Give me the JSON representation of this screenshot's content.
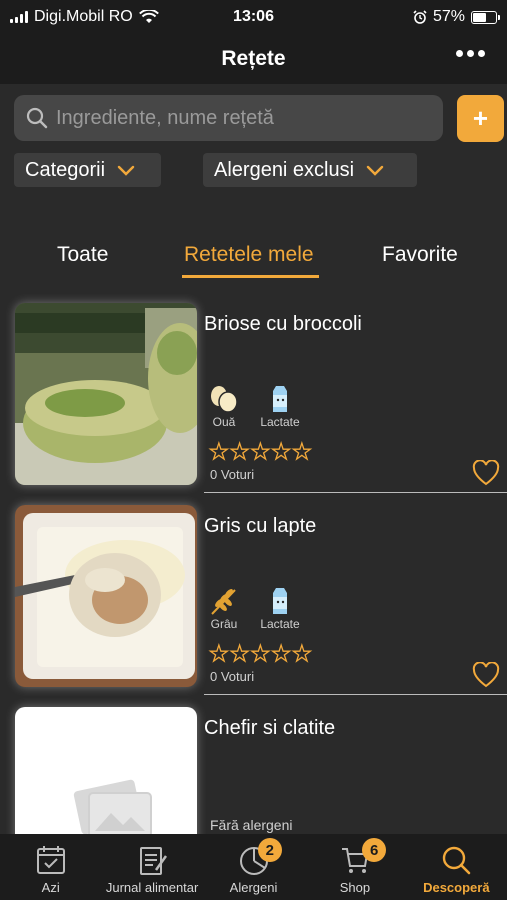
{
  "status_bar": {
    "carrier": "Digi.Mobil RO",
    "time": "13:06",
    "battery": "57%",
    "battery_level": 0.57
  },
  "header": {
    "title": "Rețete"
  },
  "search": {
    "placeholder": "Ingrediente, nume rețetă",
    "add_label": "+"
  },
  "filters": {
    "categories": "Categorii",
    "allergens": "Alergeni exclusi"
  },
  "tabs": [
    {
      "label": "Toate",
      "active": false
    },
    {
      "label": "Retetele mele",
      "active": true
    },
    {
      "label": "Favorite",
      "active": false
    }
  ],
  "recipes": [
    {
      "title": "Briose cu broccoli",
      "allergens": [
        {
          "label": "Ouă",
          "icon": "eggs-icon"
        },
        {
          "label": "Lactate",
          "icon": "milk-icon"
        }
      ],
      "rating": 0,
      "votes": "0 Voturi"
    },
    {
      "title": "Gris cu lapte",
      "allergens": [
        {
          "label": "Grâu",
          "icon": "wheat-icon"
        },
        {
          "label": "Lactate",
          "icon": "milk-icon"
        }
      ],
      "rating": 0,
      "votes": "0 Voturi"
    },
    {
      "title": "Chefir si clatite",
      "no_allergens": "Fără alergeni"
    }
  ],
  "bottom_nav": [
    {
      "label": "Azi",
      "icon": "calendar-icon"
    },
    {
      "label": "Jurnal alimentar",
      "icon": "journal-icon"
    },
    {
      "label": "Alergeni",
      "icon": "pie-chart-icon",
      "badge": "2"
    },
    {
      "label": "Shop",
      "icon": "shopping-cart-icon",
      "badge": "6"
    },
    {
      "label": "Descoperă",
      "icon": "search-icon",
      "active": true
    }
  ],
  "colors": {
    "accent": "#f2a93b",
    "background": "#2a2a2a",
    "bar": "#1c1c1c"
  }
}
